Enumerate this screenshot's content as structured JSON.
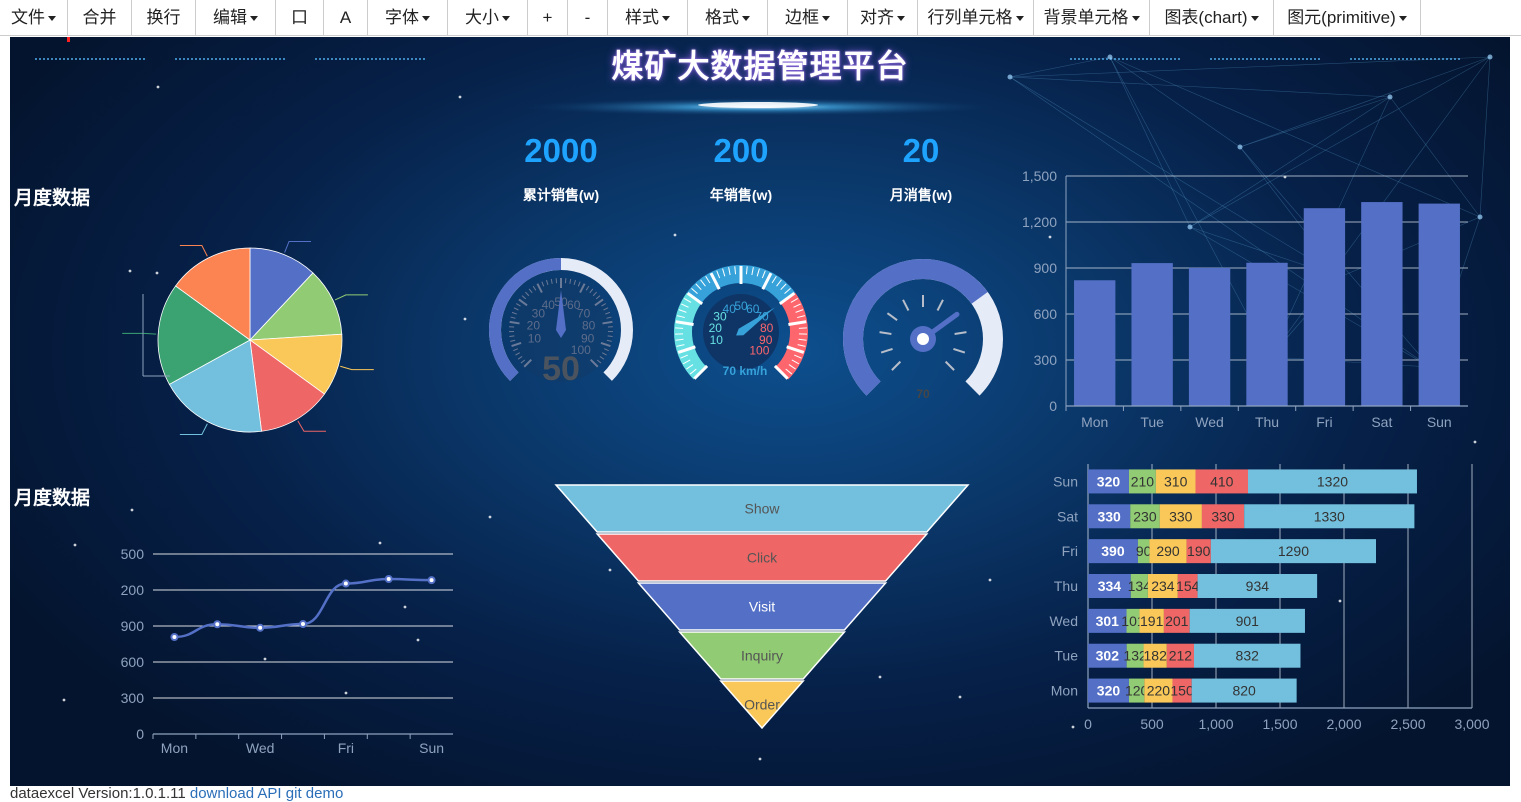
{
  "toolbar": {
    "items": [
      {
        "label": "文件",
        "dropdown": true
      },
      {
        "label": "合并",
        "dropdown": false
      },
      {
        "label": "换行",
        "dropdown": false
      },
      {
        "label": "编辑",
        "dropdown": true
      },
      {
        "label": "口",
        "dropdown": false
      },
      {
        "label": "A",
        "dropdown": false
      },
      {
        "label": "字体",
        "dropdown": true
      },
      {
        "label": "大小",
        "dropdown": true
      },
      {
        "label": "+",
        "dropdown": false
      },
      {
        "label": "-",
        "dropdown": false
      },
      {
        "label": "样式",
        "dropdown": true
      },
      {
        "label": "格式",
        "dropdown": true
      },
      {
        "label": "边框",
        "dropdown": true
      },
      {
        "label": "对齐",
        "dropdown": true
      },
      {
        "label": "行列单元格",
        "dropdown": true
      },
      {
        "label": "背景单元格",
        "dropdown": true
      },
      {
        "label": "图表(chart)",
        "dropdown": true
      },
      {
        "label": "图元(primitive)",
        "dropdown": true
      }
    ]
  },
  "dashboard": {
    "title": "煤矿大数据管理平台",
    "pie_section_label": "月度数据",
    "line_section_label": "月度数据",
    "kpis": [
      {
        "value": "2000",
        "label": "累计销售(w)"
      },
      {
        "value": "200",
        "label": "年销售(w)"
      },
      {
        "value": "20",
        "label": "月消售(w)"
      }
    ]
  },
  "colors": {
    "blue": "#5470c6",
    "green": "#91cc75",
    "yellow": "#fac858",
    "red": "#ee6666",
    "cyan": "#73c0de",
    "teal": "#3ba272",
    "orange": "#fc8452",
    "kpi": "#1ea3ff"
  },
  "chart_data": [
    {
      "type": "pie",
      "title": "",
      "slices": [
        {
          "value": 12,
          "color": "#5470c6"
        },
        {
          "value": 12,
          "color": "#91cc75"
        },
        {
          "value": 11,
          "color": "#fac858"
        },
        {
          "value": 13,
          "color": "#ee6666"
        },
        {
          "value": 19,
          "color": "#73c0de"
        },
        {
          "value": 18,
          "color": "#3ba272"
        },
        {
          "value": 15,
          "color": "#fc8452"
        }
      ]
    },
    {
      "type": "gauge",
      "value": 50,
      "value_label": "50",
      "ticks": [
        "10",
        "20",
        "30",
        "40",
        "50",
        "60",
        "70",
        "80",
        "90",
        "100"
      ],
      "progress": 0.5
    },
    {
      "type": "gauge",
      "value": 70,
      "value_label": "70 km/h",
      "ticks": [
        "10",
        "20",
        "30",
        "40",
        "50",
        "60",
        "70",
        "80",
        "90",
        "100"
      ],
      "zones": [
        "#67e0e3",
        "#37a2da",
        "#fd666d"
      ]
    },
    {
      "type": "gauge",
      "value": 70,
      "value_label": "70",
      "progress": 0.7
    },
    {
      "type": "bar",
      "categories": [
        "Mon",
        "Tue",
        "Wed",
        "Thu",
        "Fri",
        "Sat",
        "Sun"
      ],
      "values": [
        820,
        932,
        901,
        934,
        1290,
        1330,
        1320
      ],
      "ylim": [
        0,
        1500
      ],
      "yticks": [
        "0",
        "300",
        "600",
        "900",
        "1,200",
        "1,500"
      ],
      "grid": true
    },
    {
      "type": "line",
      "categories": [
        "Mon",
        "Tue",
        "Wed",
        "Thu",
        "Fri",
        "Sat",
        "Sun"
      ],
      "xtick_labels": [
        "Mon",
        "Wed",
        "Fri",
        "Sun"
      ],
      "values": [
        820,
        932,
        901,
        934,
        1290,
        1330,
        1320
      ],
      "yticks": [
        "0",
        "300",
        "600",
        "900",
        "200",
        "500"
      ],
      "ylim": [
        0,
        1500
      ],
      "smooth": true
    },
    {
      "type": "funnel",
      "stages": [
        {
          "name": "Show",
          "value": 100,
          "color": "#73c0de"
        },
        {
          "name": "Click",
          "value": 80,
          "color": "#ee6666"
        },
        {
          "name": "Visit",
          "value": 60,
          "color": "#5470c6"
        },
        {
          "name": "Inquiry",
          "value": 40,
          "color": "#91cc75"
        },
        {
          "name": "Order",
          "value": 20,
          "color": "#fac858"
        }
      ]
    },
    {
      "type": "bar",
      "orientation": "horizontal",
      "stacked": true,
      "categories": [
        "Mon",
        "Tue",
        "Wed",
        "Thu",
        "Fri",
        "Sat",
        "Sun"
      ],
      "xlim": [
        0,
        3000
      ],
      "xticks": [
        "0",
        "500",
        "1,000",
        "1,500",
        "2,000",
        "2,500",
        "3,000"
      ],
      "series": [
        {
          "values": [
            320,
            302,
            301,
            334,
            390,
            330,
            320
          ],
          "color": "#5470c6"
        },
        {
          "values": [
            120,
            132,
            101,
            134,
            90,
            230,
            210
          ],
          "color": "#91cc75"
        },
        {
          "values": [
            220,
            182,
            191,
            234,
            290,
            330,
            310
          ],
          "color": "#fac858"
        },
        {
          "values": [
            150,
            212,
            201,
            154,
            190,
            330,
            410
          ],
          "color": "#ee6666"
        },
        {
          "values": [
            820,
            832,
            901,
            934,
            1290,
            1330,
            1320
          ],
          "color": "#73c0de"
        }
      ]
    }
  ],
  "footer": {
    "version_text": "dataexcel Version:1.0.1.11",
    "link_text": "download API git demo"
  }
}
